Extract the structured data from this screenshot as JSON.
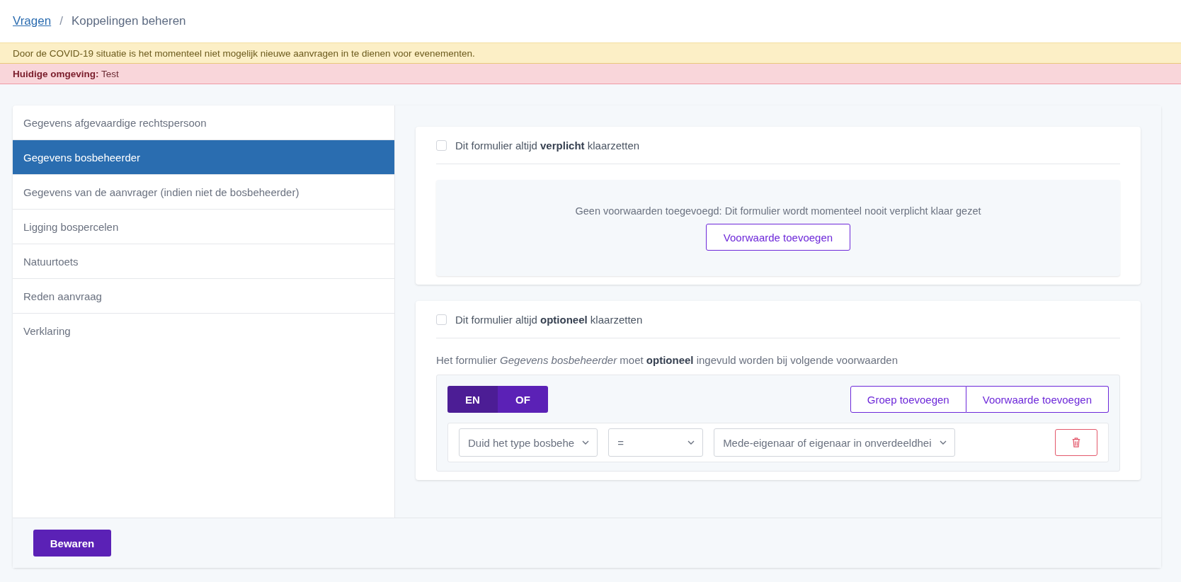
{
  "breadcrumb": [
    {
      "label": "Vragen",
      "kind": "link"
    },
    {
      "label": "/",
      "kind": "separator"
    },
    {
      "label": "Koppelingen beheren",
      "kind": "current"
    }
  ],
  "notices": [
    {
      "kind": "warning",
      "text": "Door de COVID-19 situatie is het momenteel niet mogelijk nieuwe aanvragen in te dienen voor evenementen."
    },
    {
      "kind": "danger",
      "text": "**Huidige omgeving:** Test"
    }
  ],
  "sidebar": {
    "items": [
      {
        "label": "Gegevens afgevaardige rechtspersoon",
        "selected": false
      },
      {
        "label": "Gegevens bosbeheerder",
        "selected": true
      },
      {
        "label": "Gegevens van de aanvrager (indien niet de bosbeheerder)",
        "selected": false
      },
      {
        "label": "Ligging bospercelen",
        "selected": false
      },
      {
        "label": "Natuurtoets",
        "selected": false
      },
      {
        "label": "Reden aanvraag",
        "selected": false
      },
      {
        "label": "Verklaring",
        "selected": false
      }
    ]
  },
  "sections": [
    {
      "kind": "empty",
      "checkbox": {
        "label": "Dit formulier altijd **verplicht** klaarzetten",
        "checked": false
      },
      "empty_text": "Geen voorwaarden toegevoegd: Dit formulier wordt momenteel nooit verplicht klaar gezet",
      "add_button": "Voorwaarde toevoegen"
    },
    {
      "kind": "conditions",
      "checkbox": {
        "label": "Dit formulier altijd **optioneel** klaarzetten",
        "checked": false
      },
      "description": "Het formulier *Gegevens bosbeheerder* moet **optioneel** ingevuld worden bij volgende voorwaarden",
      "operator_toggle": [
        {
          "label": "EN",
          "selected": true
        },
        {
          "label": "OF",
          "selected": false
        }
      ],
      "group_buttons": [
        "Groep toevoegen",
        "Voorwaarde toevoegen"
      ],
      "conditions": [
        {
          "field": "Duid het type bosbehe",
          "operator": "=",
          "value": "Mede-eigenaar of eigenaar in onverdeeldhei"
        }
      ]
    }
  ],
  "save_button": "Bewaren"
}
